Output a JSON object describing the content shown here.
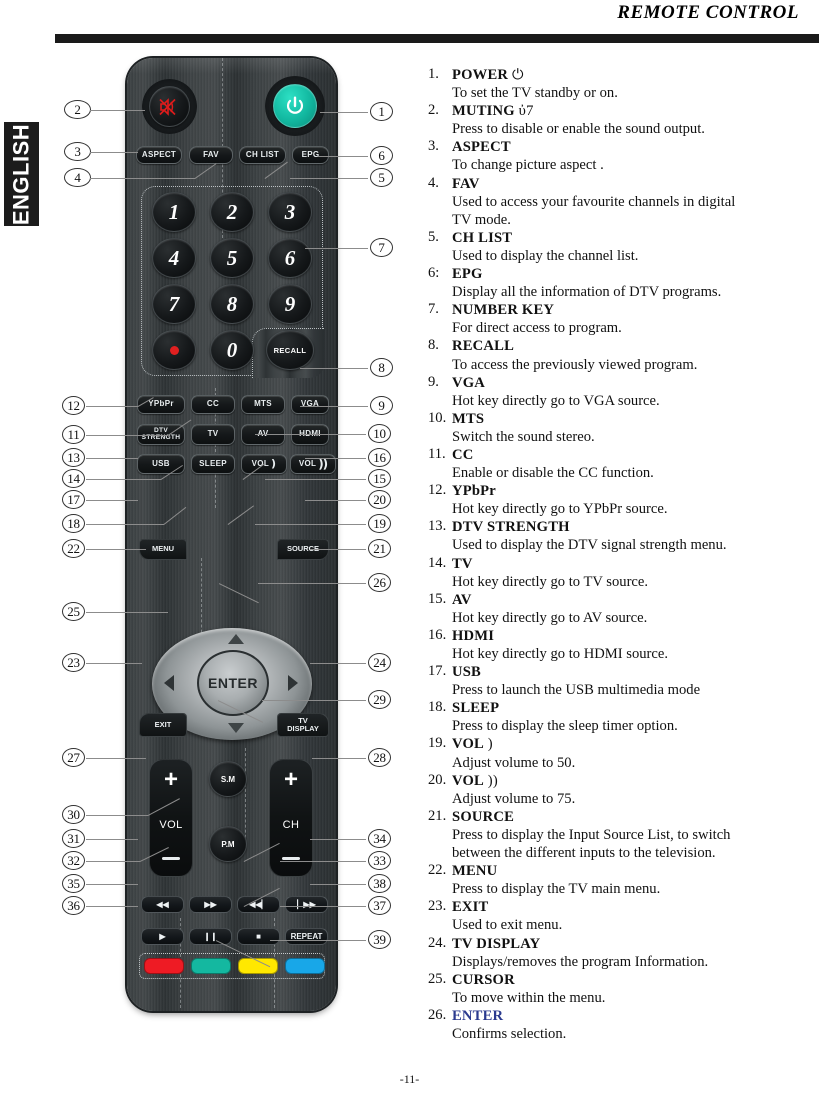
{
  "header": {
    "title": "REMOTE CONTROL"
  },
  "language_tab": {
    "label": "ENGLISH"
  },
  "page_number": "-11-",
  "remote": {
    "power_icon": "power-symbol",
    "mute_icon": "muted-speaker",
    "function_row": [
      "ASPECT",
      "FAV",
      "CH LIST",
      "EPG"
    ],
    "keypad": [
      "1",
      "2",
      "3",
      "4",
      "5",
      "6",
      "7",
      "8",
      "9",
      "dot",
      "0"
    ],
    "recall": "RECALL",
    "source_row_1": [
      "YPbPr",
      "CC",
      "MTS",
      "VGA"
    ],
    "source_row_2": [
      "DTV\nSTRENGTH",
      "TV",
      "AV",
      "HDMI"
    ],
    "source_row_3": [
      "USB",
      "SLEEP",
      "VOL )",
      "VOL ))"
    ],
    "vol_down_label": "VOL",
    "vol_up_label": "VOL",
    "menu": "MENU",
    "source": "SOURCE",
    "enter": "ENTER",
    "exit": "EXIT",
    "tv_display": "TV\nDISPLAY",
    "sound_mode": "S.M",
    "picture_mode": "P.M",
    "vol_rocker": "VOL",
    "ch_rocker": "CH",
    "media": {
      "rewind": "◀◀",
      "fastforward": "▶▶",
      "prev": "◀◀▏",
      "next": "▏▶▶",
      "play": "▶",
      "pause": "❙❙",
      "stop": "■",
      "repeat": "REPEAT"
    },
    "color_keys": [
      {
        "name": "red",
        "hex": "#ee1b24"
      },
      {
        "name": "green",
        "hex": "#14b8a0"
      },
      {
        "name": "yellow",
        "hex": "#ffe800"
      },
      {
        "name": "blue",
        "hex": "#18a7e8"
      }
    ]
  },
  "callouts_left": [
    "2",
    "3",
    "4",
    "12",
    "11",
    "13",
    "14",
    "17",
    "18",
    "22",
    "25",
    "23",
    "27",
    "30",
    "31",
    "32",
    "35",
    "36"
  ],
  "callouts_right": [
    "1",
    "6",
    "5",
    "7",
    "8",
    "9",
    "10",
    "16",
    "15",
    "20",
    "19",
    "21",
    "26",
    "24",
    "29",
    "28",
    "34",
    "33",
    "38",
    "37",
    "39"
  ],
  "descriptions": [
    {
      "num": "1.",
      "title": "POWER",
      "glyph": " ⏻",
      "desc": "To set the TV standby or on."
    },
    {
      "num": "2.",
      "title": "MUTING",
      "glyph": "  ὐ7",
      "desc": "Press to disable or enable the sound output."
    },
    {
      "num": "3.",
      "title": "ASPECT",
      "glyph": "",
      "desc": "To change picture aspect ."
    },
    {
      "num": "4.",
      "title": "FAV",
      "glyph": "",
      "desc": " Used to access your favourite channels in  digital\n TV mode."
    },
    {
      "num": "5.",
      "title": "CH LIST",
      "glyph": "",
      "desc": "Used to display the channel list."
    },
    {
      "num": "6:",
      "title": "EPG",
      "glyph": "",
      "desc": "Display all the information of DTV programs."
    },
    {
      "num": "7.",
      "title": "NUMBER KEY",
      "glyph": "",
      "desc": "For direct access to program."
    },
    {
      "num": "8.",
      "title": "RECALL",
      "glyph": "",
      "desc": "To access the previously viewed program."
    },
    {
      "num": "9.",
      "title": "VGA",
      "glyph": "",
      "desc": " Hot key directly go to VGA source."
    },
    {
      "num": "10.",
      "title": "MTS",
      "glyph": "",
      "desc": " Switch the sound stereo."
    },
    {
      "num": "11.",
      "title": "CC",
      "glyph": "",
      "desc": "Enable or disable the CC function."
    },
    {
      "num": "12.",
      "title": "YPbPr",
      "glyph": "",
      "desc": " Hot key directly go to YPbPr source."
    },
    {
      "num": "13.",
      "title": "DTV STRENGTH",
      "glyph": "",
      "desc": " Used to display the DTV signal strength menu."
    },
    {
      "num": "14.",
      "title": "TV",
      "glyph": "",
      "desc": " Hot key directly go to TV source."
    },
    {
      "num": "15.",
      "title": "AV",
      "glyph": "",
      "desc": "Hot key directly go to AV source."
    },
    {
      "num": "16.",
      "title": "HDMI",
      "glyph": "",
      "desc": " Hot key directly go to HDMI source."
    },
    {
      "num": "17.",
      "title": "USB",
      "glyph": "",
      "desc": " Press to launch the USB multimedia mode"
    },
    {
      "num": "18.",
      "title": "SLEEP",
      "glyph": "",
      "desc": " Press to display the sleep timer option."
    },
    {
      "num": "19.",
      "title": "VOL",
      "glyph": " )",
      "desc": " Adjust volume to 50."
    },
    {
      "num": "20.",
      "title": "VOL",
      "glyph": " ))",
      "desc": " Adjust volume to 75."
    },
    {
      "num": "21.",
      "title": "SOURCE",
      "glyph": "",
      "desc": "Press to display the Input Source List, to switch\nbetween the different inputs to the television."
    },
    {
      "num": "22.",
      "title": "MENU",
      "glyph": "",
      "desc": "Press to display the TV main menu."
    },
    {
      "num": "23.",
      "title": "EXIT",
      "glyph": "",
      "desc": "Used to  exit menu."
    },
    {
      "num": "24.",
      "title": "TV DISPLAY",
      "glyph": "",
      "desc": "Displays/removes the program Information."
    },
    {
      "num": "25.",
      "title": "CURSOR",
      "glyph": "",
      "desc": "To move within the menu."
    },
    {
      "num": "26.",
      "title": "ENTER",
      "glyph": "",
      "desc": "Confirms selection.",
      "color": "#2b3a8f"
    }
  ]
}
